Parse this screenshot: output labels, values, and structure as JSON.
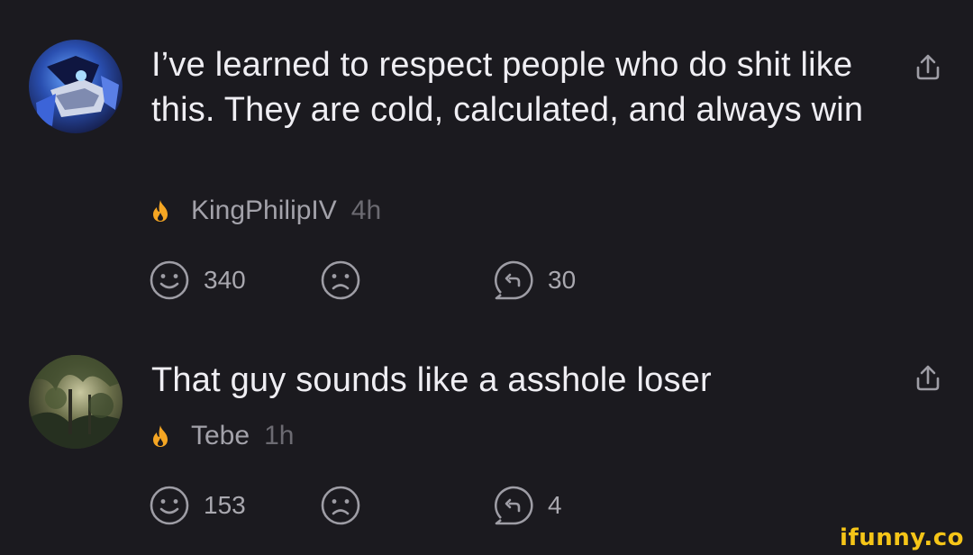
{
  "comments": [
    {
      "text": "I’ve learned to respect people who do shit like this. They are cold, calculated, and always win",
      "username": "KingPhilipIV",
      "time": "4h",
      "smile_count": "340",
      "replies_count": "30"
    },
    {
      "text": "That guy sounds like a asshole loser",
      "username": "Tebe",
      "time": "1h",
      "smile_count": "153",
      "replies_count": "4"
    }
  ],
  "watermark": "ifunny.co",
  "colors": {
    "background": "#1b1a1f",
    "text": "#efeef3",
    "username": "#a3a2aa",
    "timestamp": "#6c6b72",
    "icon": "#9e9da5",
    "flame": "#f5a623",
    "watermark": "#f5c518"
  },
  "icons": {
    "flame": "flame-icon",
    "share": "share-icon",
    "smile": "smile-icon",
    "frown": "frown-icon",
    "reply": "reply-icon"
  }
}
